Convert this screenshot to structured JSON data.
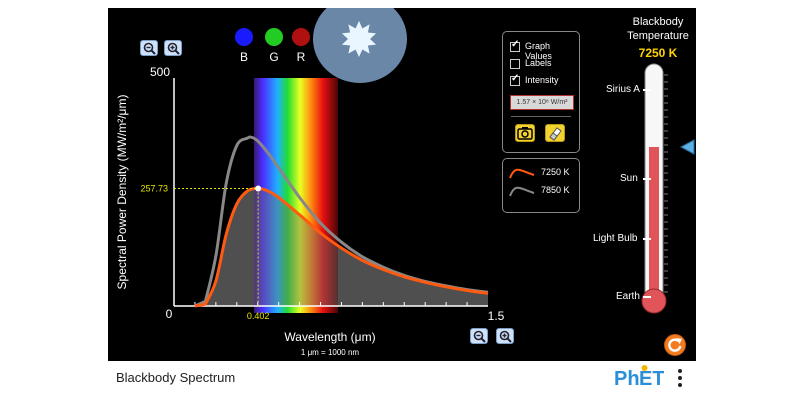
{
  "footer": {
    "title": "Blackbody Spectrum",
    "logo": "PhET"
  },
  "filters": [
    {
      "label": "B",
      "color": "#1a1aff"
    },
    {
      "label": "G",
      "color": "#22cc22"
    },
    {
      "label": "R",
      "color": "#b01010"
    }
  ],
  "graph": {
    "y_max_label": "500",
    "zero_label": "0",
    "x_max_label": "1.5",
    "y_axis_label": "Spectral Power Density (MW/m²/μm)",
    "x_axis_label": "Wavelength (μm)",
    "x_units_note": "1 μm  =  1000 nm",
    "marker_value": "257.73",
    "marker_wavelength": "0.402"
  },
  "controls": {
    "graph_values_label": "Graph Values",
    "labels_label": "Labels",
    "intensity_label": "Intensity",
    "graph_values_checked": true,
    "labels_checked": false,
    "intensity_checked": true,
    "intensity_value": "1.57 × 10⁸ W/m²"
  },
  "legend": {
    "current": "7250 K",
    "saved": "7850 K"
  },
  "thermometer": {
    "title_line1": "Blackbody",
    "title_line2": "Temperature",
    "value": "7250 K",
    "labels": [
      "Sirius A",
      "Sun",
      "Light Bulb",
      "Earth"
    ]
  },
  "colors": {
    "current_curve": "#ff5a10",
    "saved_curve": "#888888",
    "temperature": "#ffd400",
    "accent": "#f47c20"
  },
  "chart_data": {
    "type": "line",
    "title": "",
    "xlabel": "Wavelength (μm)",
    "ylabel": "Spectral Power Density (MW/m²/μm)",
    "xlim": [
      0,
      1.5
    ],
    "ylim": [
      0,
      500
    ],
    "series": [
      {
        "name": "7250 K",
        "x": [
          0.15,
          0.2,
          0.25,
          0.3,
          0.35,
          0.402,
          0.45,
          0.5,
          0.6,
          0.7,
          0.8,
          0.9,
          1.0,
          1.1,
          1.2,
          1.3,
          1.4,
          1.5
        ],
        "y": [
          4,
          55,
          158,
          224,
          252,
          258,
          252,
          238,
          200,
          160,
          127,
          100,
          80,
          64,
          52,
          42,
          34,
          28
        ]
      },
      {
        "name": "7850 K",
        "x": [
          0.15,
          0.2,
          0.25,
          0.3,
          0.35,
          0.37,
          0.4,
          0.45,
          0.5,
          0.6,
          0.7,
          0.8,
          0.9,
          1.0,
          1.1,
          1.2,
          1.3,
          1.4,
          1.5
        ],
        "y": [
          10,
          110,
          270,
          352,
          368,
          370,
          362,
          335,
          303,
          238,
          182,
          140,
          108,
          85,
          67,
          54,
          44,
          36,
          30
        ]
      }
    ],
    "annotation": {
      "x": 0.402,
      "y": 257.73
    }
  }
}
